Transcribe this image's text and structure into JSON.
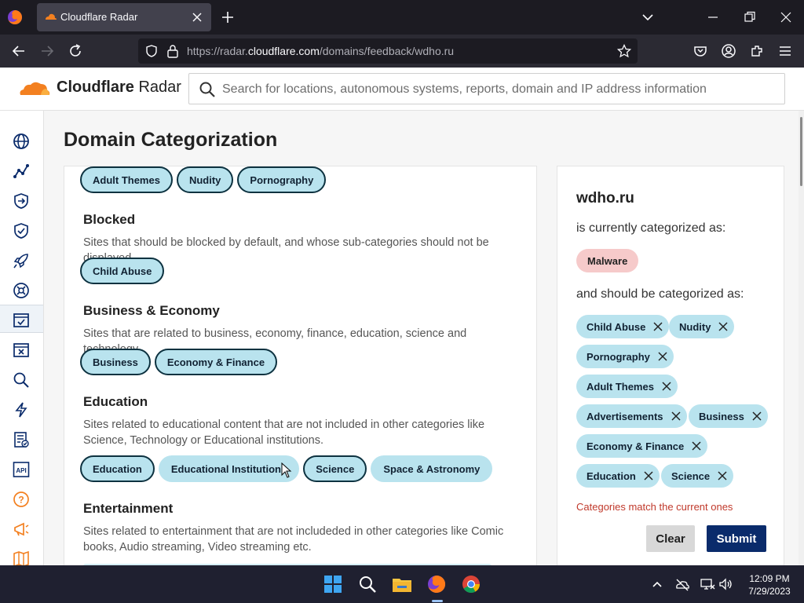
{
  "browser": {
    "tab_title": "Cloudflare Radar",
    "url_prefix": "https://radar.",
    "url_host": "cloudflare.com",
    "url_path": "/domains/feedback/wdho.ru"
  },
  "header": {
    "brand_bold": "Cloudflare",
    "brand_light": " Radar",
    "search_placeholder": "Search for locations, autonomous systems, reports, domain and IP address information"
  },
  "sidebar": {
    "items": [
      {
        "icon": "globe-icon"
      },
      {
        "icon": "traffic-trends-icon"
      },
      {
        "icon": "routing-icon"
      },
      {
        "icon": "security-shield-icon"
      },
      {
        "icon": "adoption-rocket-icon"
      },
      {
        "icon": "outage-center-icon"
      },
      {
        "icon": "domain-categorization-icon"
      },
      {
        "icon": "url-scanner-icon"
      },
      {
        "icon": "search-icon"
      },
      {
        "icon": "speed-test-icon"
      },
      {
        "icon": "reports-icon"
      },
      {
        "icon": "api-icon"
      },
      {
        "icon": "help-icon"
      },
      {
        "icon": "announcements-icon"
      },
      {
        "icon": "docs-icon"
      }
    ]
  },
  "main": {
    "title": "Domain Categorization",
    "top_chips": [
      {
        "label": "Adult Themes",
        "selected": true
      },
      {
        "label": "Nudity",
        "selected": true
      },
      {
        "label": "Pornography",
        "selected": true
      }
    ],
    "sections": [
      {
        "title": "Blocked",
        "desc": "Sites that should be blocked by default, and whose sub-categories should not be displayed",
        "chips": [
          {
            "label": "Child Abuse",
            "selected": true
          }
        ]
      },
      {
        "title": "Business & Economy",
        "desc": "Sites that are related to business, economy, finance, education, science and technology.",
        "chips": [
          {
            "label": "Business",
            "selected": true
          },
          {
            "label": "Economy & Finance",
            "selected": true
          }
        ]
      },
      {
        "title": "Education",
        "desc": "Sites related to educational content that are not included in other categories like Science, Technology or Educational institutions.",
        "chips": [
          {
            "label": "Education",
            "selected": true
          },
          {
            "label": "Educational Institutions",
            "selected": false
          },
          {
            "label": "Science",
            "selected": true
          },
          {
            "label": "Space & Astronomy",
            "selected": false
          }
        ]
      },
      {
        "title": "Entertainment",
        "desc": "Sites related to entertainment that are not includeded in other categories like Comic books, Audio streaming, Video streaming etc.",
        "chips": []
      }
    ]
  },
  "request": {
    "domain": "wdho.ru",
    "current_label": "is currently categorized as:",
    "current_category": "Malware",
    "should_label": "and should be categorized as:",
    "selected": [
      "Child Abuse",
      "Nudity",
      "Pornography",
      "Adult Themes",
      "Advertisements",
      "Business",
      "Economy & Finance",
      "Education",
      "Science"
    ],
    "warning": "Categories match the current ones",
    "clear_label": "Clear",
    "submit_label": "Submit"
  },
  "colors": {
    "chip_bg": "#b9e3ee",
    "chip_border_selected": "#0d3240",
    "malware_bg": "#f6caca",
    "submit_bg": "#0a2b6b",
    "warning": "#c0392b",
    "brand_orange": "#f38020"
  },
  "taskbar": {
    "time": "12:09 PM",
    "date": "7/29/2023"
  }
}
